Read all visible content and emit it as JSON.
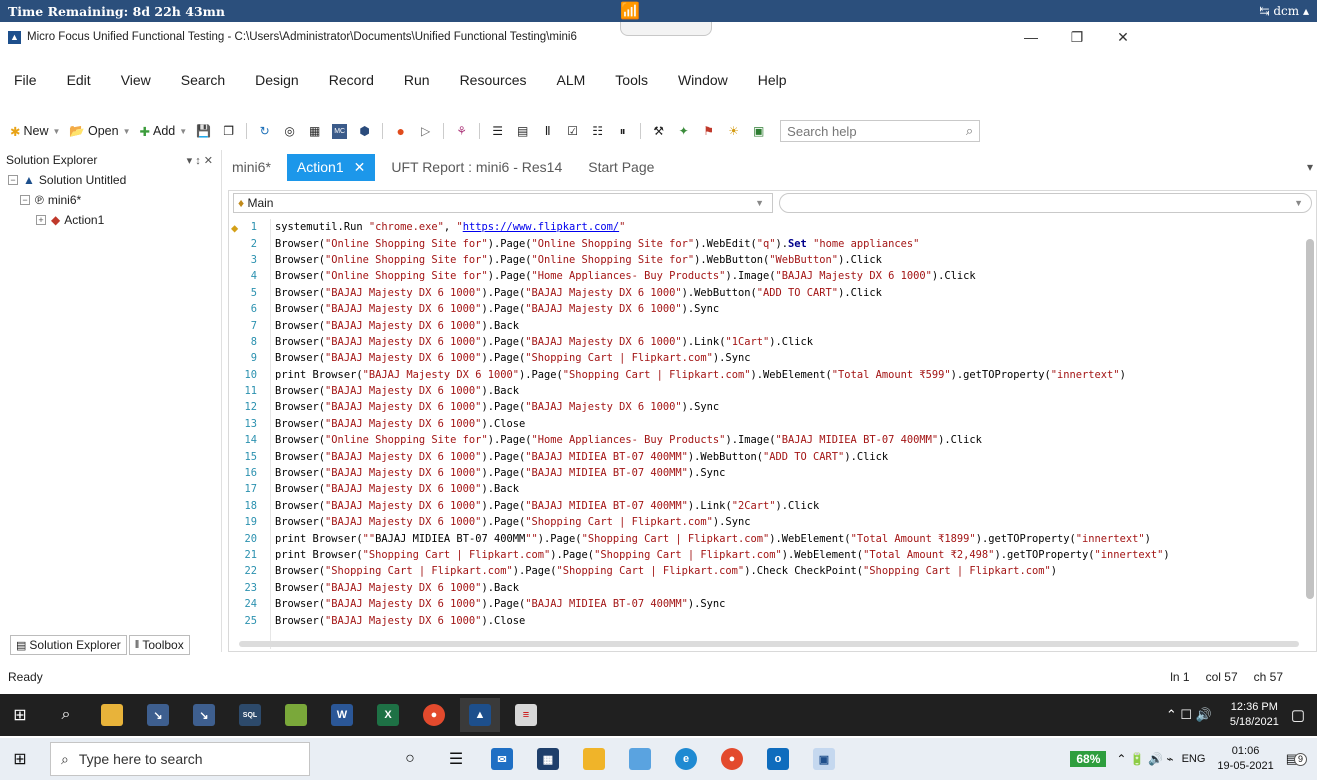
{
  "remote": {
    "time_remaining": "Time Remaining: 8d 22h 43mn",
    "user": "dcm"
  },
  "window": {
    "title": "Micro Focus Unified Functional Testing - C:\\Users\\Administrator\\Documents\\Unified Functional Testing\\mini6"
  },
  "menu": [
    "File",
    "Edit",
    "View",
    "Search",
    "Design",
    "Record",
    "Run",
    "Resources",
    "ALM",
    "Tools",
    "Window",
    "Help"
  ],
  "toolbar": {
    "new_label": "New",
    "open_label": "Open",
    "add_label": "Add",
    "search_placeholder": "Search help"
  },
  "solution_explorer": {
    "title": "Solution Explorer",
    "solution": "Solution Untitled",
    "test": "mini6*",
    "action": "Action1",
    "tabs": [
      "Solution Explorer",
      "Toolbox"
    ]
  },
  "doc_tabs": [
    {
      "label": "mini6*",
      "active": false
    },
    {
      "label": "Action1",
      "active": true
    },
    {
      "label": "UFT Report : mini6 - Res14",
      "active": false
    },
    {
      "label": "Start Page",
      "active": false
    }
  ],
  "editor": {
    "scope": "Main",
    "lines": [
      "systemutil.Run \"chrome.exe\", \"https://www.flipkart.com/\"",
      "Browser(\"Online Shopping Site for\").Page(\"Online Shopping Site for\").WebEdit(\"q\").Set \"home appliances\"",
      "Browser(\"Online Shopping Site for\").Page(\"Online Shopping Site for\").WebButton(\"WebButton\").Click",
      "Browser(\"Online Shopping Site for\").Page(\"Home Appliances- Buy Products\").Image(\"BAJAJ Majesty DX 6 1000\").Click",
      "Browser(\"BAJAJ Majesty DX 6 1000\").Page(\"BAJAJ Majesty DX 6 1000\").WebButton(\"ADD TO CART\").Click",
      "Browser(\"BAJAJ Majesty DX 6 1000\").Page(\"BAJAJ Majesty DX 6 1000\").Sync",
      "Browser(\"BAJAJ Majesty DX 6 1000\").Back",
      "Browser(\"BAJAJ Majesty DX 6 1000\").Page(\"BAJAJ Majesty DX 6 1000\").Link(\"1Cart\").Click",
      "Browser(\"BAJAJ Majesty DX 6 1000\").Page(\"Shopping Cart | Flipkart.com\").Sync",
      "print Browser(\"BAJAJ Majesty DX 6 1000\").Page(\"Shopping Cart | Flipkart.com\").WebElement(\"Total Amount ₹599\").getTOProperty(\"innertext\")",
      "Browser(\"BAJAJ Majesty DX 6 1000\").Back",
      "Browser(\"BAJAJ Majesty DX 6 1000\").Page(\"BAJAJ Majesty DX 6 1000\").Sync",
      "Browser(\"BAJAJ Majesty DX 6 1000\").Close",
      "Browser(\"Online Shopping Site for\").Page(\"Home Appliances- Buy Products\").Image(\"BAJAJ MIDIEA BT-07 400MM\").Click",
      "Browser(\"BAJAJ Majesty DX 6 1000\").Page(\"BAJAJ MIDIEA BT-07 400MM\").WebButton(\"ADD TO CART\").Click",
      "Browser(\"BAJAJ Majesty DX 6 1000\").Page(\"BAJAJ MIDIEA BT-07 400MM\").Sync",
      "Browser(\"BAJAJ Majesty DX 6 1000\").Back",
      "Browser(\"BAJAJ Majesty DX 6 1000\").Page(\"BAJAJ MIDIEA BT-07 400MM\").Link(\"2Cart\").Click",
      "Browser(\"BAJAJ Majesty DX 6 1000\").Page(\"Shopping Cart | Flipkart.com\").Sync",
      "print Browser(\"\"BAJAJ MIDIEA BT-07 400MM\"\").Page(\"Shopping Cart | Flipkart.com\").WebElement(\"Total Amount ₹1899\").getTOProperty(\"innertext\")",
      "print Browser(\"Shopping Cart | Flipkart.com\").Page(\"Shopping Cart | Flipkart.com\").WebElement(\"Total Amount ₹2,498\").getTOProperty(\"innertext\")",
      "Browser(\"Shopping Cart | Flipkart.com\").Page(\"Shopping Cart | Flipkart.com\").Check CheckPoint(\"Shopping Cart | Flipkart.com\")",
      "Browser(\"BAJAJ Majesty DX 6 1000\").Back",
      "Browser(\"BAJAJ Majesty DX 6 1000\").Page(\"BAJAJ MIDIEA BT-07 400MM\").Sync",
      "Browser(\"BAJAJ Majesty DX 6 1000\").Close"
    ]
  },
  "status": {
    "text": "Ready",
    "line": "ln 1",
    "col": "col 57",
    "ch": "ch 57"
  },
  "taskbar_remote": {
    "time": "12:36 PM",
    "date": "5/18/2021"
  },
  "taskbar_local": {
    "search_placeholder": "Type here to search",
    "battery": "68%",
    "lang": "ENG",
    "time": "01:06",
    "date": "19-05-2021",
    "notifications": "9"
  },
  "colors": {
    "remote_bar": "#2b4f7c",
    "active_tab": "#1c97ea",
    "line_number": "#2b91af",
    "string": "#a31515"
  }
}
